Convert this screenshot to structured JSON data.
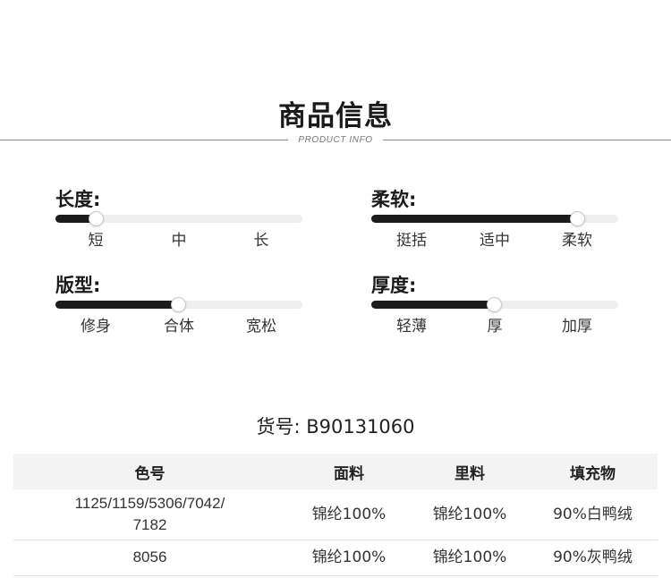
{
  "header": {
    "title": "商品信息",
    "subtitle": "PRODUCT INFO"
  },
  "attributes": {
    "length": {
      "label": "长度:",
      "value_fraction": 0.0,
      "options": [
        "短",
        "中",
        "长"
      ]
    },
    "softness": {
      "label": "柔软:",
      "value_fraction": 1.0,
      "options": [
        "挺括",
        "适中",
        "柔软"
      ]
    },
    "fit": {
      "label": "版型:",
      "value_fraction": 0.5,
      "options": [
        "修身",
        "合体",
        "宽松"
      ]
    },
    "thickness": {
      "label": "厚度:",
      "value_fraction": 0.5,
      "options": [
        "轻薄",
        "厚",
        "加厚"
      ]
    }
  },
  "sku": {
    "text": "货号: B90131060"
  },
  "spec_table": {
    "headers": [
      "色号",
      "面料",
      "里料",
      "填充物"
    ],
    "rows": [
      [
        "1125/1159/5306/7042/\n7182",
        "锦纶100%",
        "锦纶100%",
        "90%白鸭绒"
      ],
      [
        "8056",
        "锦纶100%",
        "锦纶100%",
        "90%灰鸭绒"
      ]
    ]
  },
  "colors": {
    "slider_fill": "#1c1c1c",
    "slider_track": "#eeeeee",
    "table_header_bg": "#f3f3f3"
  }
}
